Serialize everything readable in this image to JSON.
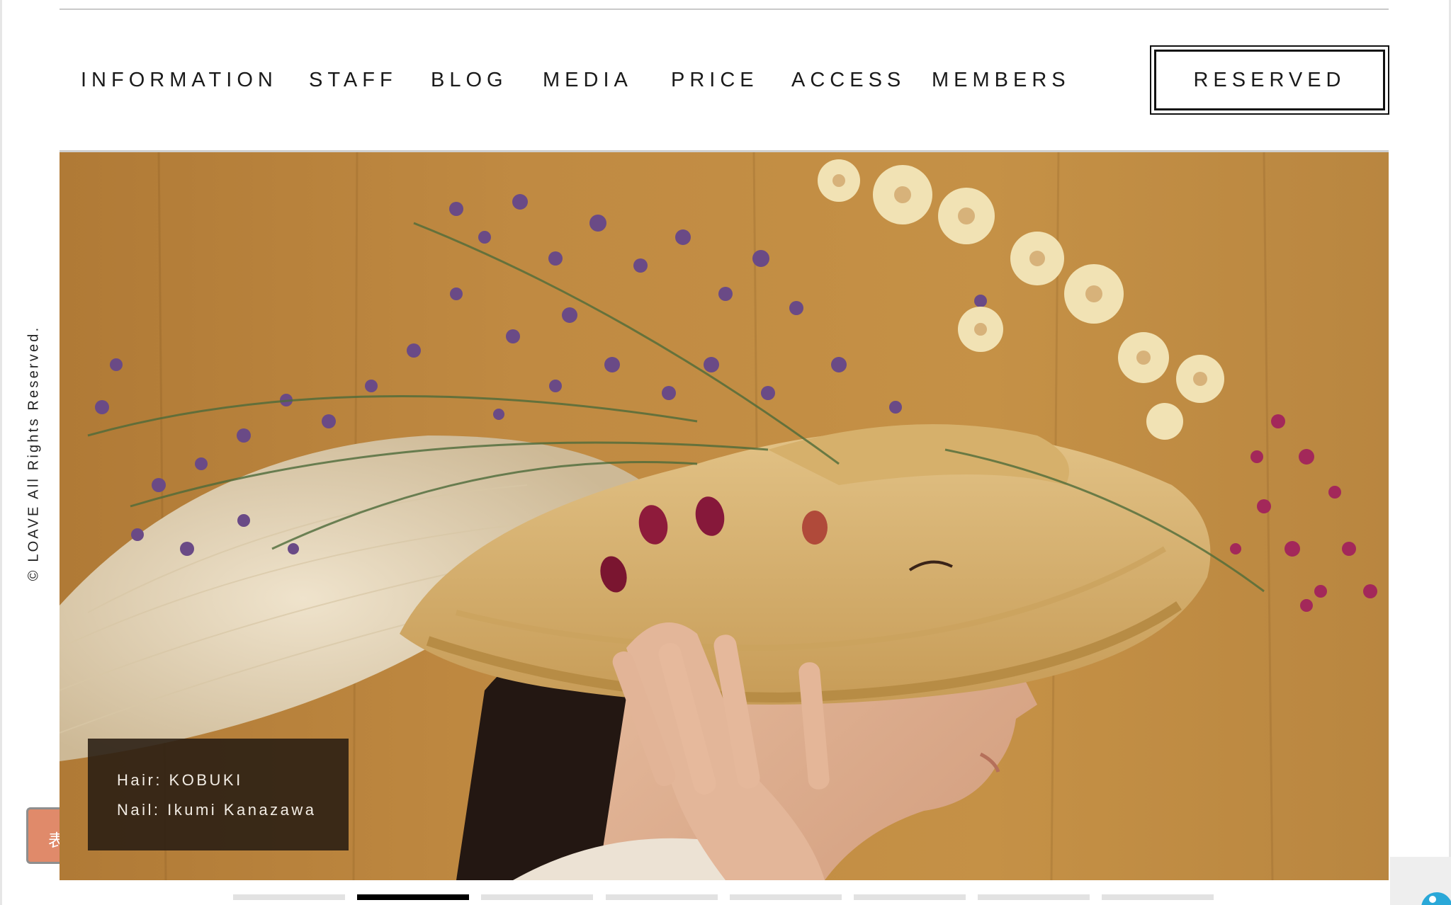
{
  "nav": {
    "items": [
      {
        "label": "INFORMATION"
      },
      {
        "label": "STAFF"
      },
      {
        "label": "BLOG"
      },
      {
        "label": "MEDIA"
      },
      {
        "label": "PRICE"
      },
      {
        "label": "ACCESS"
      },
      {
        "label": "MEMBERS"
      }
    ],
    "reserved_label": "RESERVED"
  },
  "sidebar": {
    "copyright": "© LOAVE All Rights Reserved.",
    "tab_glyph": "表"
  },
  "hero": {
    "caption": {
      "hair": "Hair: KOBUKI",
      "nail": "Nail: Ikumi Kanazawa"
    }
  },
  "slider": {
    "count": 8,
    "active_index": 1
  },
  "colors": {
    "text": "#1a1a1a",
    "caption_bg": "#281c12",
    "side_tab": "#e08a6a",
    "dot_active": "#000000",
    "dot_inactive": "#e2e2e2",
    "widget_icon": "#2aa8d8"
  }
}
